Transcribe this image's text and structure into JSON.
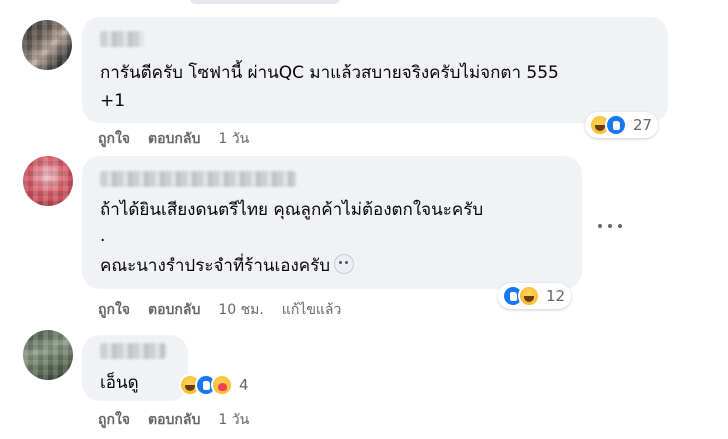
{
  "comments": [
    {
      "text_lines": [
        "การันตีครับ โซฟานี้ ผ่านQC มาแล้วสบายจริงครับไม่จกตา 555",
        "+1"
      ],
      "reactions": {
        "icons": [
          "haha-icon",
          "like-icon"
        ],
        "count": "27"
      },
      "actions": {
        "like": "ถูกใจ",
        "reply": "ตอบกลับ",
        "time": "1 วัน"
      }
    },
    {
      "text_lines": [
        "ถ้าได้ยินเสียงดนตรีไทย คุณลูกค้าไม่ต้องตกใจนะครับ",
        ".",
        "คณะนางรำประจำที่ร้านเองครับ"
      ],
      "inline_emoji": "ghost-emoji-icon",
      "reactions": {
        "icons": [
          "like-icon",
          "haha-icon"
        ],
        "count": "12"
      },
      "actions": {
        "like": "ถูกใจ",
        "reply": "ตอบกลับ",
        "time": "10 ชม.",
        "edited": "แก้ไขแล้ว"
      }
    },
    {
      "text_lines": [
        "เอ็นดู"
      ],
      "reactions": {
        "icons": [
          "haha-icon",
          "like-icon",
          "care-icon"
        ],
        "count": "4"
      },
      "actions": {
        "like": "ถูกใจ",
        "reply": "ตอบกลับ",
        "time": "1 วัน"
      }
    }
  ],
  "colors": {
    "bubble": "#f0f2f5",
    "secondary_text": "#65676b",
    "like_blue": "#1877f2"
  }
}
